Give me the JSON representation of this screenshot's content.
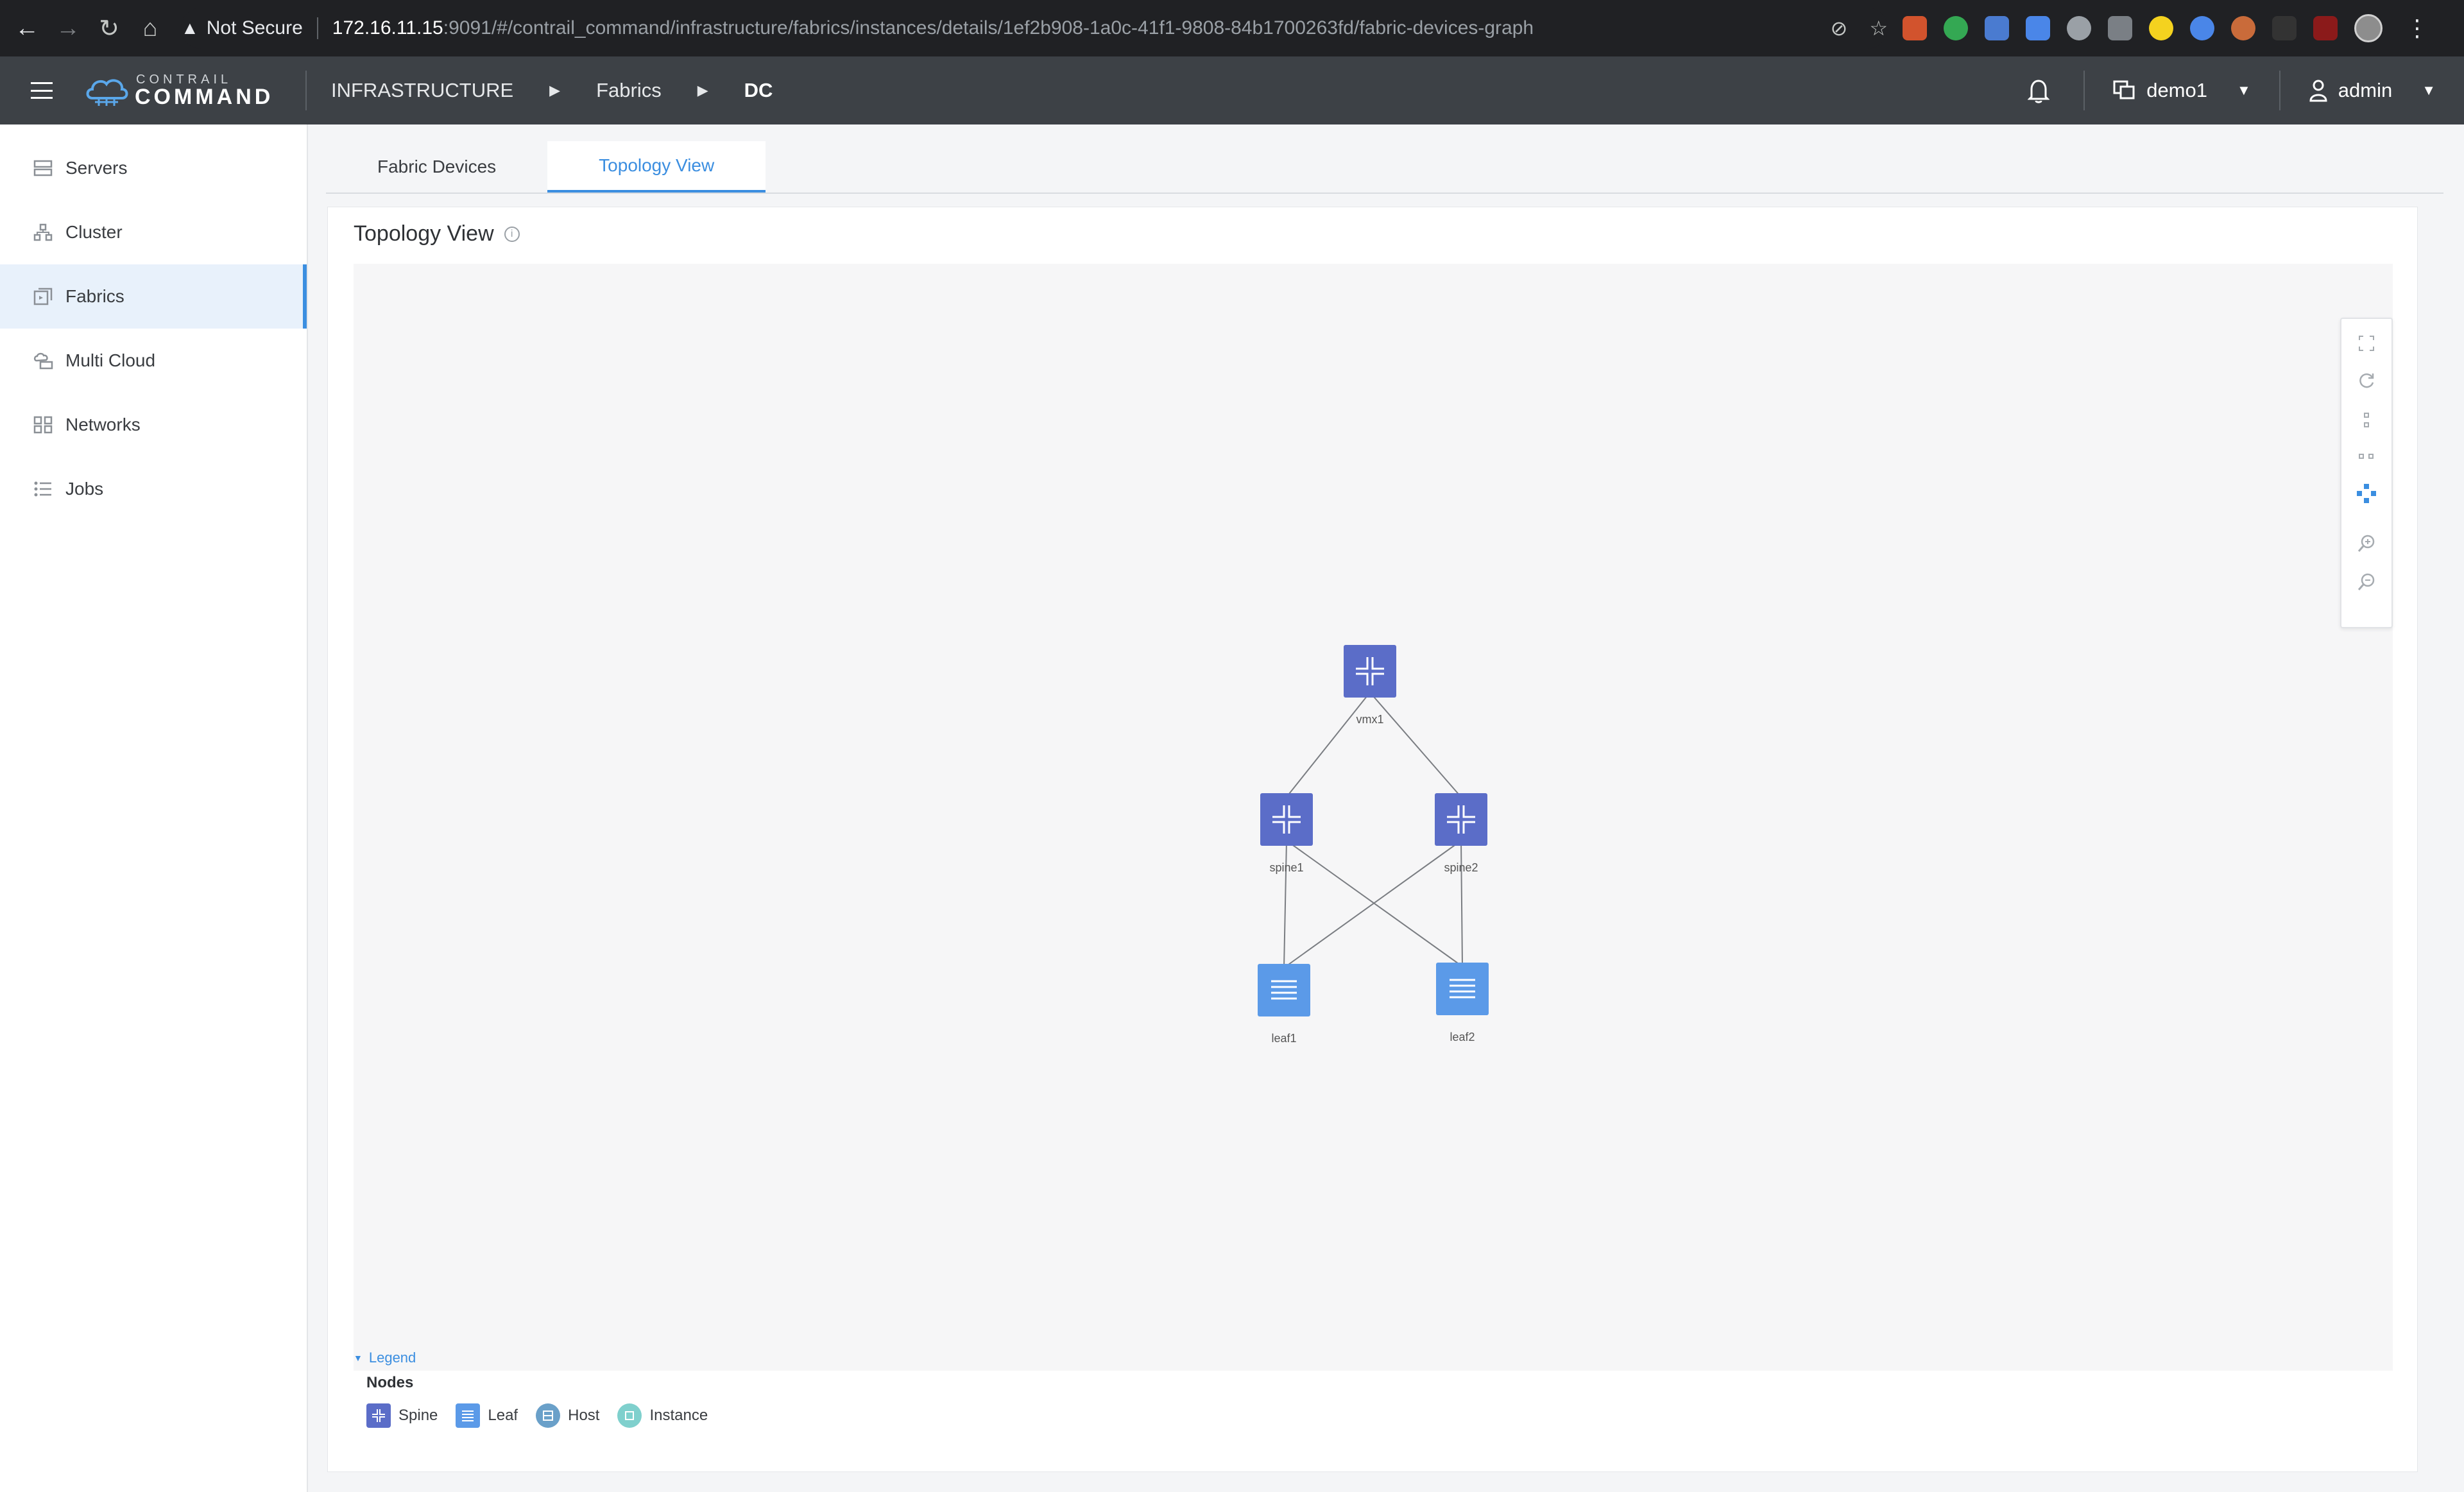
{
  "browser": {
    "security_label": "Not Secure",
    "url_host": "172.16.11.15",
    "url_rest": ":9091/#/contrail_command/infrastructure/fabrics/instances/details/1ef2b908-1a0c-41f1-9808-84b1700263fd/fabric-devices-graph"
  },
  "header": {
    "logo_small": "CONTRAIL",
    "logo_big": "COMMAND",
    "breadcrumbs": [
      "INFRASTRUCTURE",
      "Fabrics",
      "DC"
    ],
    "project": "demo1",
    "user": "admin"
  },
  "sidebar": {
    "items": [
      {
        "label": "Servers",
        "icon": "server-icon"
      },
      {
        "label": "Cluster",
        "icon": "cluster-icon"
      },
      {
        "label": "Fabrics",
        "icon": "fabrics-icon",
        "active": true
      },
      {
        "label": "Multi Cloud",
        "icon": "multicloud-icon"
      },
      {
        "label": "Networks",
        "icon": "networks-icon"
      },
      {
        "label": "Jobs",
        "icon": "jobs-icon"
      }
    ]
  },
  "tabs": [
    {
      "label": "Fabric Devices"
    },
    {
      "label": "Topology View",
      "active": true
    }
  ],
  "card": {
    "title": "Topology View"
  },
  "topology": {
    "nodes": [
      {
        "id": "vmx1",
        "label": "vmx1",
        "role": "spine"
      },
      {
        "id": "spine1",
        "label": "spine1",
        "role": "spine"
      },
      {
        "id": "spine2",
        "label": "spine2",
        "role": "spine"
      },
      {
        "id": "leaf1",
        "label": "leaf1",
        "role": "leaf"
      },
      {
        "id": "leaf2",
        "label": "leaf2",
        "role": "leaf"
      }
    ],
    "links": [
      [
        "vmx1",
        "spine1"
      ],
      [
        "vmx1",
        "spine2"
      ],
      [
        "spine1",
        "leaf1"
      ],
      [
        "spine1",
        "leaf2"
      ],
      [
        "spine2",
        "leaf1"
      ],
      [
        "spine2",
        "leaf2"
      ]
    ]
  },
  "legend": {
    "toggle_label": "Legend",
    "section_title": "Nodes",
    "items": [
      {
        "label": "Spine",
        "icon": "spine-icon",
        "color": "#5b6dc8"
      },
      {
        "label": "Leaf",
        "icon": "leaf-icon",
        "color": "#5b9ae8"
      },
      {
        "label": "Host",
        "icon": "host-icon",
        "color": "#6aa0c9"
      },
      {
        "label": "Instance",
        "icon": "instance-icon",
        "color": "#7fd0cd"
      }
    ]
  },
  "colors": {
    "accent": "#3b8ee0",
    "header_bg": "#3d4146",
    "spine": "#5b6dc8",
    "leaf": "#5b9ae8"
  }
}
